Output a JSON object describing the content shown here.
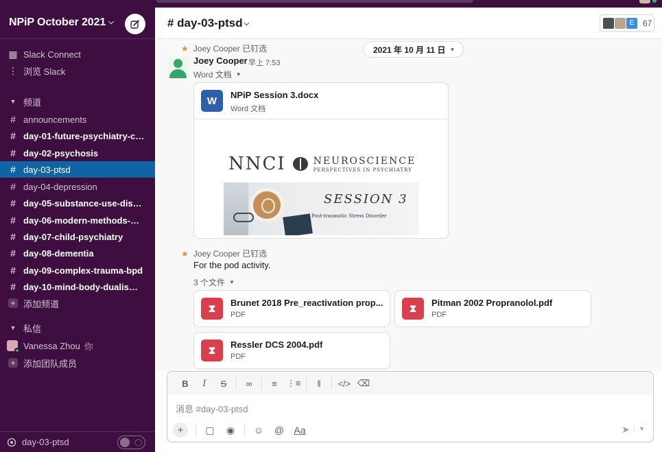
{
  "workspace": {
    "name": "NPiP October 2021"
  },
  "sidebar": {
    "top_items": [
      {
        "label": "Slack Connect"
      },
      {
        "label": "浏览 Slack"
      }
    ],
    "channels_header": "频道",
    "channels": [
      {
        "label": "announcements",
        "bold": false,
        "active": false
      },
      {
        "label": "day-01-future-psychiatry-cli...",
        "bold": true,
        "active": false
      },
      {
        "label": "day-02-psychosis",
        "bold": true,
        "active": false
      },
      {
        "label": "day-03-ptsd",
        "bold": false,
        "active": true
      },
      {
        "label": "day-04-depression",
        "bold": false,
        "active": false
      },
      {
        "label": "day-05-substance-use-disor...",
        "bold": true,
        "active": false
      },
      {
        "label": "day-06-modern-methods-m...",
        "bold": true,
        "active": false
      },
      {
        "label": "day-07-child-psychiatry",
        "bold": true,
        "active": false
      },
      {
        "label": "day-08-dementia",
        "bold": true,
        "active": false
      },
      {
        "label": "day-09-complex-trauma-bpd",
        "bold": true,
        "active": false
      },
      {
        "label": "day-10-mind-body-dualism-...",
        "bold": true,
        "active": false
      }
    ],
    "add_channel": "添加频道",
    "dm_header": "私信",
    "dms": [
      {
        "label": "Vanessa Zhou",
        "suffix": "你"
      }
    ],
    "add_teammates": "添加团队成员",
    "footer": {
      "label": "day-03-ptsd"
    }
  },
  "header": {
    "channel": "# day-03-ptsd",
    "member_count": "67",
    "member_initial": "E"
  },
  "messages": {
    "date_pill": "2021 年 10 月 11 日",
    "pinned_1": "Joey Cooper 已钉选",
    "author": "Joey Cooper",
    "time": "早上 7:53",
    "word_meta": "Word 文档",
    "word_file": {
      "name": "NPiP Session 3.docx",
      "type": "Word 文档",
      "icon_letter": "W",
      "preview": {
        "logo": "NNCI",
        "neuro_line1": "NEUROSCIENCE",
        "neuro_line2": "PERSPECTIVES IN PSYCHIATRY",
        "session_title": "SESSION 3",
        "session_subtitle": "Post-traumatic Stress Disorder"
      }
    },
    "pinned_2": "Joey Cooper 已钉选",
    "text": "For the pod activity.",
    "files_meta": "3 个文件",
    "pdf_files": [
      {
        "name": "Brunet 2018 Pre_reactivation prop...",
        "type": "PDF"
      },
      {
        "name": "Pitman 2002 Propranolol.pdf",
        "type": "PDF"
      },
      {
        "name": "Ressler DCS 2004.pdf",
        "type": "PDF"
      }
    ]
  },
  "composer": {
    "placeholder": "消息 #day-03-ptsd",
    "format_label": "Aa"
  },
  "colors": {
    "sidebar_bg": "#3f0e40",
    "active_channel": "#1164a3",
    "pin": "#e8912d",
    "word": "#2f5faa",
    "pdf": "#d93f4c",
    "presence": "#2bac76"
  }
}
